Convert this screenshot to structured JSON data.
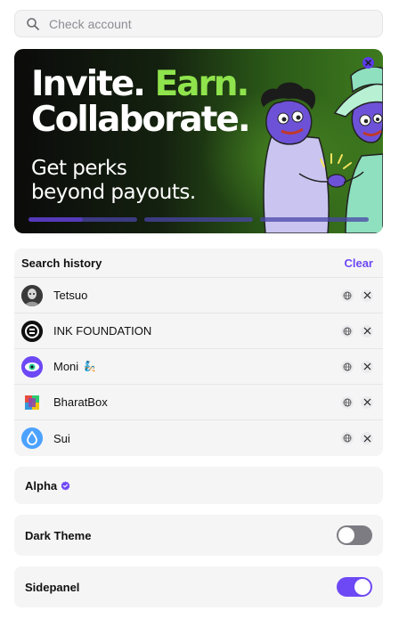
{
  "search": {
    "placeholder": "Check account",
    "value": ""
  },
  "banner": {
    "title_line1_a": "Invite.",
    "title_line1_b": "Earn.",
    "title_line2": "Collaborate.",
    "subtitle_line1": "Get perks",
    "subtitle_line2": "beyond payouts.",
    "slides_total": 3,
    "active_slide": 1,
    "active_slide_progress": 0.5
  },
  "history": {
    "title": "Search history",
    "clear_label": "Clear",
    "items": [
      {
        "name": "Tetsuo",
        "avatar": "tetsuo-avatar",
        "badge": ""
      },
      {
        "name": "INK FOUNDATION",
        "avatar": "ink-logo",
        "badge": ""
      },
      {
        "name": "Moni",
        "avatar": "moni-eye-logo",
        "badge": "🧞"
      },
      {
        "name": "BharatBox",
        "avatar": "bharatbox-logo",
        "badge": ""
      },
      {
        "name": "Sui",
        "avatar": "sui-droplet-logo",
        "badge": ""
      }
    ]
  },
  "alpha": {
    "label": "Alpha"
  },
  "dark_theme": {
    "label": "Dark Theme",
    "enabled": false
  },
  "sidepanel": {
    "label": "Sidepanel",
    "enabled": true
  },
  "colors": {
    "accent": "#6d48f5",
    "earn_green": "#8fe34c",
    "toggle_off": "#7c7c82",
    "card_bg": "#f5f5f6"
  }
}
